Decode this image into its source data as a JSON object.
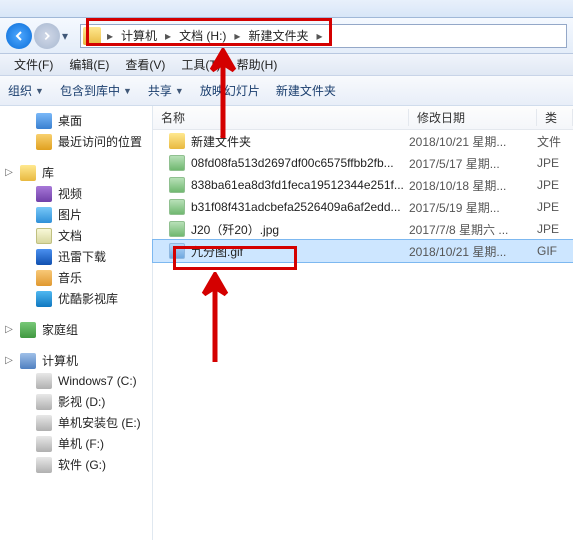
{
  "breadcrumb": {
    "a": "计算机",
    "b": "文档 (H:)",
    "c": "新建文件夹"
  },
  "menu": {
    "file": "文件(F)",
    "edit": "编辑(E)",
    "view": "查看(V)",
    "tools": "工具(T)",
    "help": "帮助(H)"
  },
  "toolbar": {
    "org": "组织",
    "include": "包含到库中",
    "share": "共享",
    "slideshow": "放映幻灯片",
    "newfolder": "新建文件夹"
  },
  "sidebar": {
    "desktop": "桌面",
    "recent": "最近访问的位置",
    "lib": "库",
    "video": "视频",
    "pic": "图片",
    "doc": "文档",
    "thunder": "迅雷下载",
    "music": "音乐",
    "youku": "优酷影视库",
    "homegroup": "家庭组",
    "computer": "计算机",
    "d1": "Windows7 (C:)",
    "d2": "影视 (D:)",
    "d3": "单机安装包 (E:)",
    "d4": "单机 (F:)",
    "d5": "软件 (G:)"
  },
  "cols": {
    "name": "名称",
    "date": "修改日期",
    "type": "类"
  },
  "files": [
    {
      "name": "新建文件夹",
      "date": "2018/10/21 星期...",
      "type": "文件",
      "icon": "folder"
    },
    {
      "name": "08fd08fa513d2697df00c6575ffbb2fb...",
      "date": "2017/5/17 星期...",
      "type": "JPE",
      "icon": "img"
    },
    {
      "name": "838ba61ea8d3fd1feca19512344e251f...",
      "date": "2018/10/18 星期...",
      "type": "JPE",
      "icon": "img"
    },
    {
      "name": "b31f08f431adcbefa2526409a6af2edd...",
      "date": "2017/5/19 星期...",
      "type": "JPE",
      "icon": "img"
    },
    {
      "name": "J20（歼20）.jpg",
      "date": "2017/7/8 星期六 ...",
      "type": "JPE",
      "icon": "img"
    },
    {
      "name": "九分图.gif",
      "date": "2018/10/21 星期...",
      "type": "GIF",
      "icon": "gif",
      "sel": true
    }
  ]
}
